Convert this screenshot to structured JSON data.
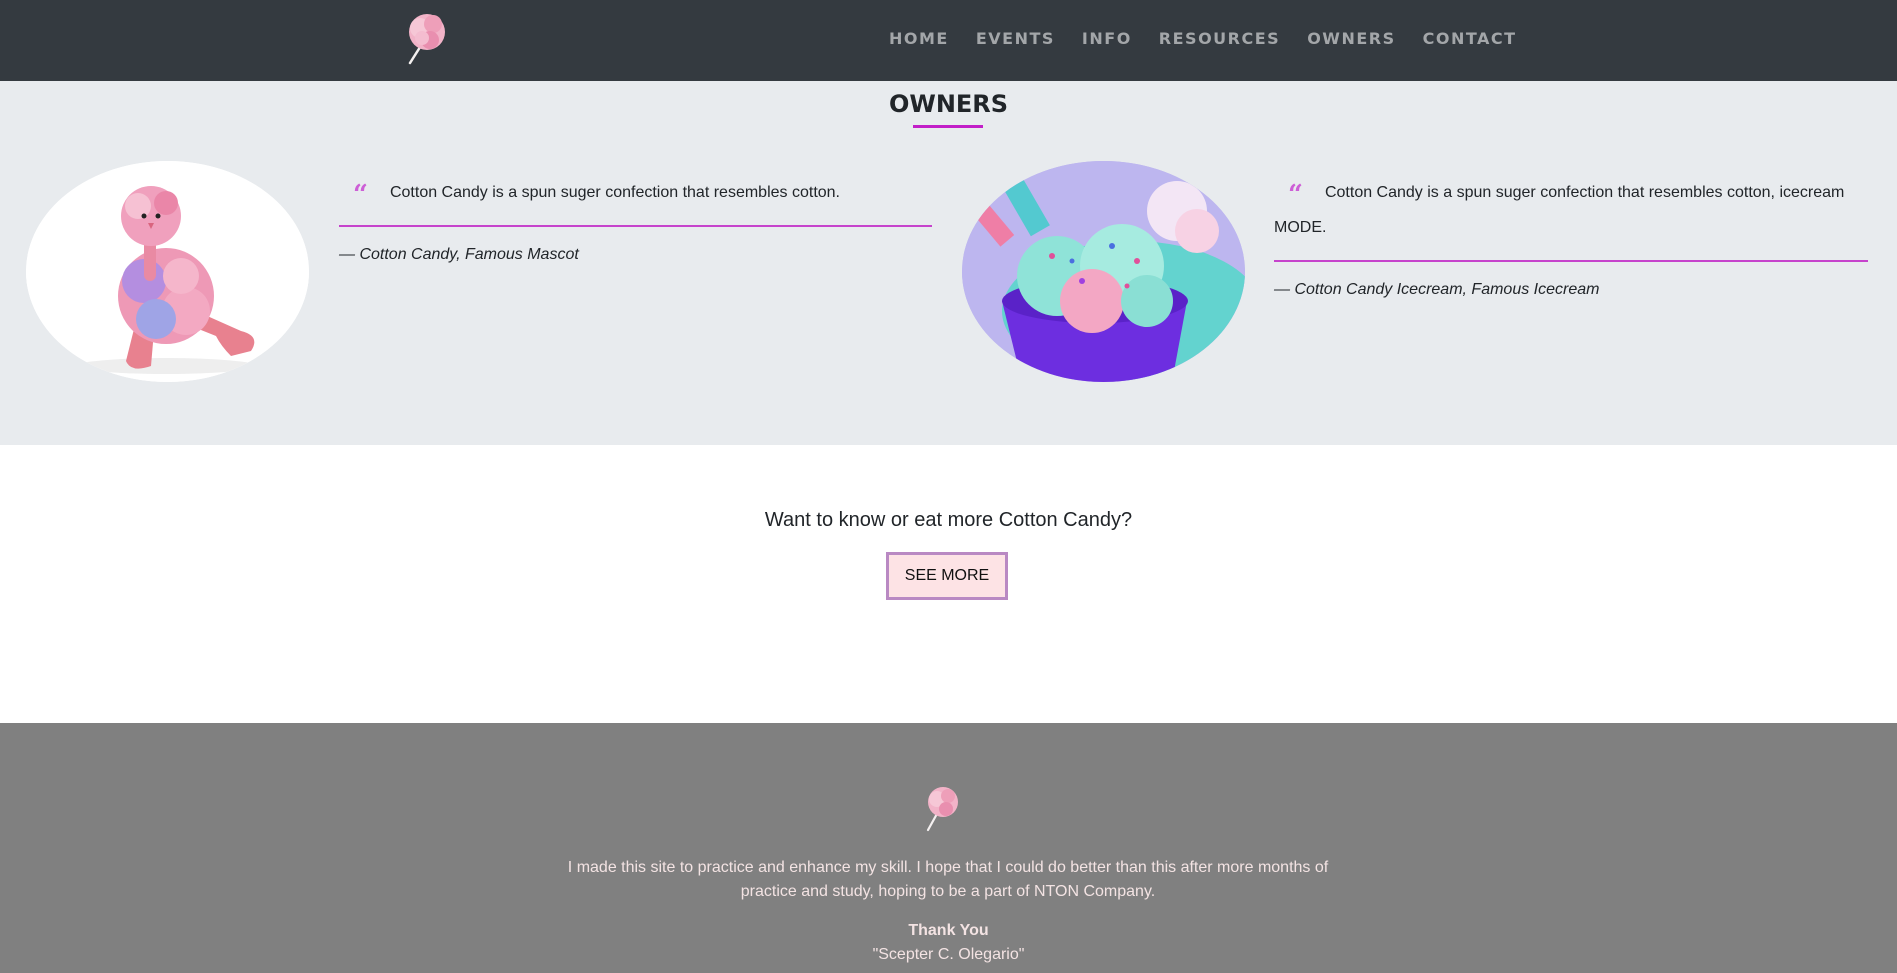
{
  "nav": {
    "logo_icon": "cotton-candy-icon",
    "links": [
      "HOME",
      "EVENTS",
      "INFO",
      "RESOURCES",
      "OWNERS",
      "CONTACT"
    ]
  },
  "owners": {
    "title": "OWNERS",
    "accent_color": "#c21fc8",
    "cards": [
      {
        "image": "cotton-candy-plush-mascot",
        "quote": "Cotton Candy is a spun suger confection that resembles cotton.",
        "author": "— Cotton Candy, Famous Mascot"
      },
      {
        "image": "cotton-candy-icecream-cup",
        "quote": "Cotton Candy is a spun suger confection that resembles cotton, icecream MODE.",
        "author": "— Cotton Candy Icecream, Famous Icecream"
      }
    ]
  },
  "cta": {
    "text": "Want to know or eat more Cotton Candy?",
    "button_label": "SEE MORE"
  },
  "footer": {
    "logo_icon": "cotton-candy-icon",
    "text": "I made this site to practice and enhance my skill. I hope that I could do better than this after more months of practice and study, hoping to be a part of NTON Company.",
    "thanks": "Thank You",
    "signature": "\"Scepter C. Olegario\""
  },
  "colors": {
    "navbar_bg": "#343a40",
    "section_bg": "#e8ebee",
    "footer_bg": "#808080",
    "button_bg": "#fde3e5"
  }
}
